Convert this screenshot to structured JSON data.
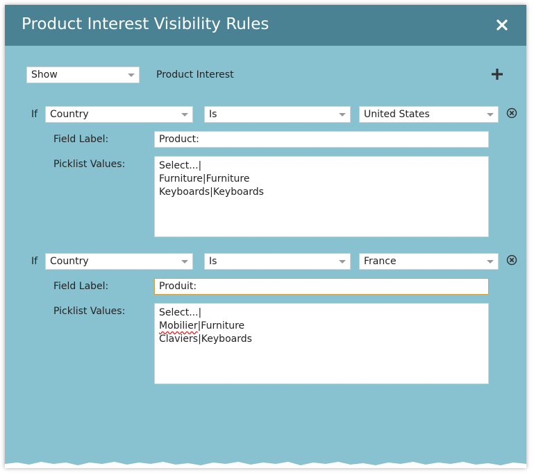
{
  "dialog": {
    "title": "Product Interest Visibility Rules",
    "close_icon": "close-icon"
  },
  "header_row": {
    "action_select": "Show",
    "field_label": "Product Interest",
    "add_icon": "plus-icon"
  },
  "rules": [
    {
      "if_label": "If",
      "field": "Country",
      "operator": "Is",
      "value": "United States",
      "field_label_caption": "Field Label:",
      "field_label_value": "Product:",
      "picklist_caption": "Picklist Values:",
      "picklist_lines": [
        "Select...|",
        "Furniture|Furniture",
        "Keyboards|Keyboards"
      ]
    },
    {
      "if_label": "If",
      "field": "Country",
      "operator": "Is",
      "value": "France",
      "field_label_caption": "Field Label:",
      "field_label_value": "Produit:",
      "picklist_caption": "Picklist Values:",
      "picklist_lines": [
        "Select...|",
        "Mobilier|Furniture",
        "Claviers|Keyboards"
      ]
    }
  ],
  "colors": {
    "background": "#88c2d0",
    "titlebar": "#4a8294",
    "focus_border": "#d9a042"
  }
}
